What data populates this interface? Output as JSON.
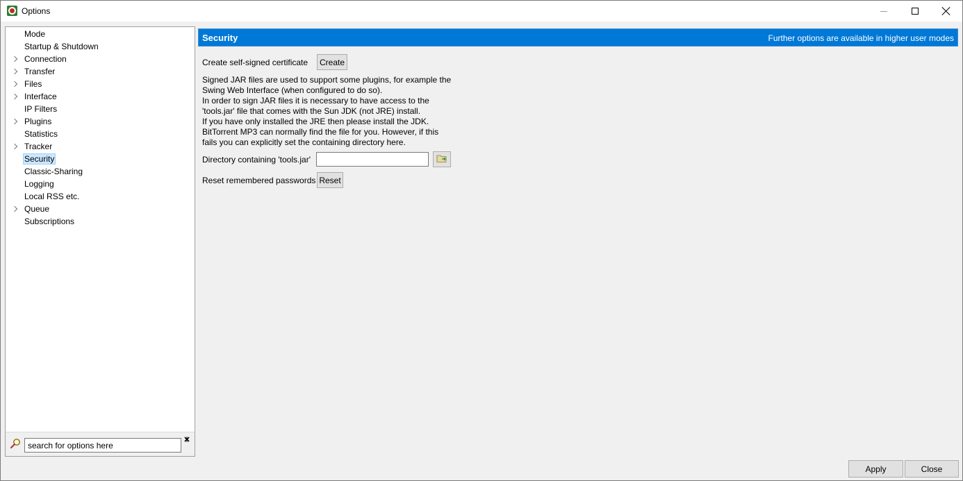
{
  "window": {
    "title": "Options"
  },
  "sidebar": {
    "items": [
      {
        "label": "Mode",
        "expandable": false
      },
      {
        "label": "Startup & Shutdown",
        "expandable": false
      },
      {
        "label": "Connection",
        "expandable": true
      },
      {
        "label": "Transfer",
        "expandable": true
      },
      {
        "label": "Files",
        "expandable": true
      },
      {
        "label": "Interface",
        "expandable": true
      },
      {
        "label": "IP Filters",
        "expandable": false
      },
      {
        "label": "Plugins",
        "expandable": true
      },
      {
        "label": "Statistics",
        "expandable": false
      },
      {
        "label": "Tracker",
        "expandable": true
      },
      {
        "label": "Security",
        "expandable": false,
        "selected": true
      },
      {
        "label": "Classic-Sharing",
        "expandable": false
      },
      {
        "label": "Logging",
        "expandable": false
      },
      {
        "label": "Local RSS etc.",
        "expandable": false
      },
      {
        "label": "Queue",
        "expandable": true
      },
      {
        "label": "Subscriptions",
        "expandable": false
      }
    ],
    "search": {
      "placeholder": "search for options here",
      "value": ""
    }
  },
  "main": {
    "header": {
      "title": "Security",
      "note": "Further options are available in higher user modes",
      "color": "#0078d7"
    },
    "certificate": {
      "label": "Create self-signed certificate",
      "button": "Create"
    },
    "description": [
      "Signed JAR files are used to support some plugins, for example the",
      "Swing Web Interface (when configured to do so).",
      "In order to sign JAR files it is necessary to have access to the",
      "'tools.jar' file that comes with the Sun JDK (not JRE) install.",
      "If you have only installed the JRE then please install the JDK.",
      "BitTorrent MP3 can normally find the file for you. However, if this",
      "fails you can explicitly set the containing directory here."
    ],
    "toolsjar": {
      "label": "Directory containing 'tools.jar'",
      "value": ""
    },
    "passwords": {
      "label": "Reset remembered passwords",
      "button": "Reset"
    }
  },
  "footer": {
    "apply": "Apply",
    "close": "Close"
  }
}
